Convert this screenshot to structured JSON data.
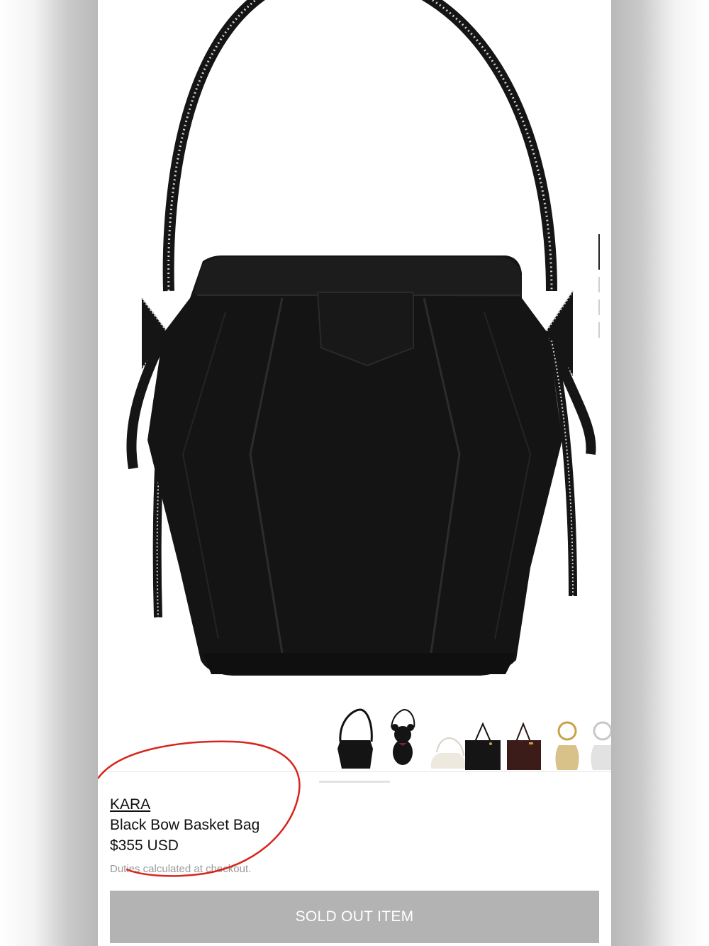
{
  "product": {
    "brand": "KARA",
    "name": "Black Bow Basket Bag",
    "price": "$355 USD",
    "duties_note": "Duties calculated at checkout.",
    "button_label": "SOLD OUT ITEM"
  },
  "gallery": {
    "image_count": 4,
    "active_index": 0
  },
  "related_items": [
    {
      "icon": "black-basket-bag-thumbnail"
    },
    {
      "icon": "teddy-bear-bag-thumbnail"
    },
    {
      "icon": "white-pouch-bag-thumbnail"
    },
    {
      "icon": "black-tote-bag-thumbnail"
    },
    {
      "icon": "brown-tote-bag-thumbnail"
    },
    {
      "icon": "gold-pouch-bag-thumbnail"
    },
    {
      "icon": "silver-pouch-bag-thumbnail"
    }
  ],
  "colors": {
    "sold_out_button": "#b3b3b3",
    "annotation_circle": "#d7261e",
    "bag": "#141414"
  }
}
